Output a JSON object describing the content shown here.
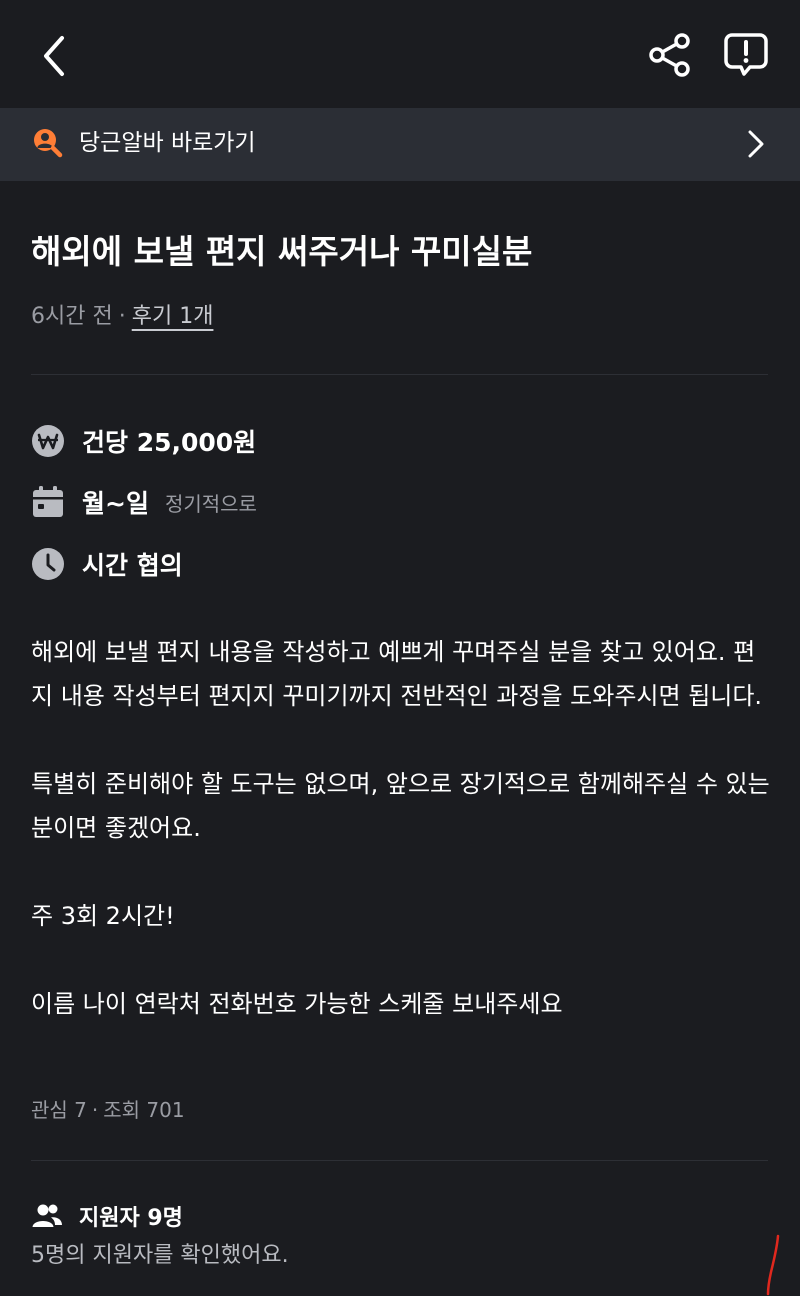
{
  "header": {
    "icons": [
      "chevron-left-icon",
      "share-icon",
      "report-icon"
    ]
  },
  "banner": {
    "label": "당근알바 바로가기",
    "accent_color": "#ff7e36"
  },
  "post": {
    "title": "해외에 보낼 편지 써주거나 꾸미실분",
    "posted_ago": "6시간 전",
    "meta_separator": "·",
    "review_link": "후기 1개"
  },
  "info": {
    "pay": "건당 25,000원",
    "days": "월~일",
    "days_note": "정기적으로",
    "time": "시간 협의"
  },
  "description": {
    "paragraphs": [
      "해외에 보낼 편지 내용을 작성하고 예쁘게 꾸며주실 분을 찾고 있어요. 편지 내용 작성부터 편지지 꾸미기까지 전반적인 과정을 도와주시면 됩니다.",
      "특별히 준비해야 할 도구는 없으며, 앞으로 장기적으로 함께해주실 수 있는 분이면 좋겠어요.",
      "주 3회 2시간!",
      "이름 나이 연락처 전화번호 가능한 스케줄 보내주세요"
    ]
  },
  "stats": {
    "interest": "관심 7",
    "separator": "·",
    "views": "조회 701"
  },
  "applicants": {
    "title": "지원자 9명",
    "subtitle": "5명의 지원자를 확인했어요."
  },
  "colors": {
    "background": "#1b1c20",
    "banner_background": "#2b2e35",
    "secondary_text": "#9a9ca3",
    "icon_gray": "#b9bbc1",
    "annotation_red": "#e0281e"
  }
}
